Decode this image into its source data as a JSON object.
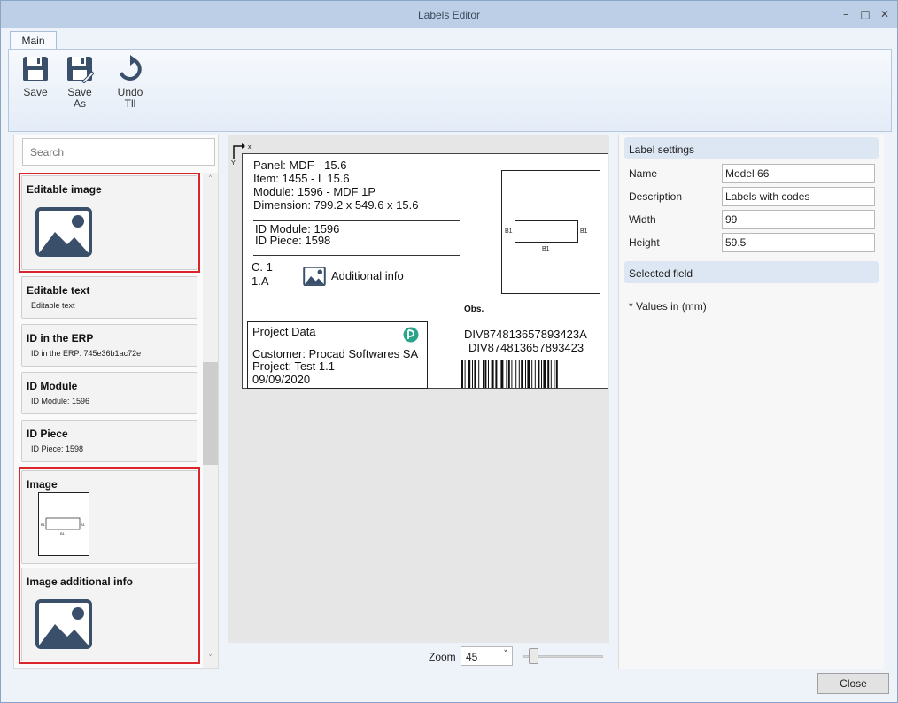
{
  "window": {
    "title": "Labels Editor"
  },
  "ribbon": {
    "tab": "Main",
    "save_label": "Save",
    "save_as_label": [
      "Save",
      "As"
    ],
    "undo_label": [
      "Undo",
      "Tll"
    ]
  },
  "search": {
    "placeholder": "Search"
  },
  "fields": [
    {
      "title": "Editable image",
      "icon": "image-placeholder-icon"
    },
    {
      "title": "Editable text",
      "subtitle": "Editable text"
    },
    {
      "title": "ID in the ERP",
      "subtitle": "ID in the ERP: 745e36b1ac72e"
    },
    {
      "title": "ID Module",
      "subtitle": "ID Module: 1596"
    },
    {
      "title": "ID Piece",
      "subtitle": "ID Piece: 1598"
    },
    {
      "title": "Image",
      "icon": "piece-drawing-thumbnail"
    },
    {
      "title": "Image additional info",
      "icon": "image-placeholder-icon"
    }
  ],
  "label": {
    "axis_x": "x",
    "axis_y": "Y",
    "panel": "Panel: MDF - 15.6",
    "item": "Item: 1455 - L 15.6",
    "module": "Module: 1596 - MDF 1P",
    "dimension": "Dimension: 799.2 x 549.6 x 15.6",
    "id_module": "ID Module: 1596",
    "id_piece": "ID Piece: 1598",
    "c_line1": "C. 1",
    "c_line2": "1.A",
    "additional_info": "Additional info",
    "obs": "Obs.",
    "edge_left": "B1",
    "edge_right": "B1",
    "edge_bottom": "B1",
    "project_title": "Project Data",
    "customer": "Customer: Procad Softwares SA",
    "project": "Project: Test 1.1",
    "date": "09/09/2020",
    "code1": "DIV874813657893423A",
    "code2": "DIV874813657893423"
  },
  "zoom": {
    "label": "Zoom",
    "value": "45"
  },
  "settings": {
    "header": "Label settings",
    "name_label": "Name",
    "name_value": "Model 66",
    "description_label": "Description",
    "description_value": "Labels with codes",
    "width_label": "Width",
    "width_value": "99",
    "height_label": "Height",
    "height_value": "59.5",
    "selected_header": "Selected field",
    "note": "* Values in (mm)"
  },
  "footer": {
    "close_label": "Close"
  },
  "colors": {
    "highlight": "#d9252b",
    "icon": "#3a4f6a",
    "accent": "#2aa58a"
  }
}
